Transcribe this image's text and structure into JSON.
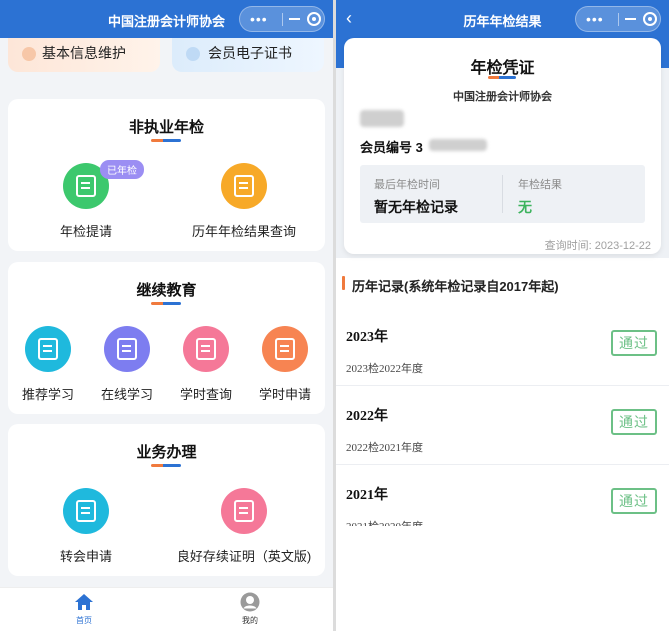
{
  "left": {
    "navbar": {
      "title": "中国注册会计师协会"
    },
    "top_links": {
      "info": "基本信息维护",
      "cert": "会员电子证书"
    },
    "annual_check": {
      "title": "非执业年检",
      "items": [
        {
          "label": "年检提请",
          "badge": "已年检",
          "color": "#3cc86d"
        },
        {
          "label": "历年年检结果查询",
          "color": "#f7a928"
        }
      ]
    },
    "education": {
      "title": "继续教育",
      "items": [
        {
          "label": "推荐学习",
          "color": "#1fb9dd"
        },
        {
          "label": "在线学习",
          "color": "#7d7df0"
        },
        {
          "label": "学时查询",
          "color": "#f57898"
        },
        {
          "label": "学时申请",
          "color": "#f78452"
        }
      ]
    },
    "business": {
      "title": "业务办理",
      "items": [
        {
          "label": "转会申请",
          "color": "#1fb9dd"
        },
        {
          "label": "良好存续证明（英文版)",
          "color": "#f57898"
        }
      ]
    },
    "tabbar": {
      "home": "首页",
      "mine": "我的",
      "active_color": "#2c72d3"
    }
  },
  "right": {
    "navbar": {
      "title": "历年年检结果"
    },
    "certificate": {
      "title": "年检凭证",
      "org": "中国注册会计师协会",
      "member_label": "会员编号 3",
      "last_check_key": "最后年检时间",
      "last_check_value": "暂无年检记录",
      "result_key": "年检结果",
      "result_value": "无",
      "query_time": "查询时间: 2023-12-22"
    },
    "section_title": "历年记录(系统年检记录自2017年起)",
    "records": [
      {
        "year": "2023年",
        "desc": "2023检2022年度",
        "status": "通过"
      },
      {
        "year": "2022年",
        "desc": "2022检2021年度",
        "status": "通过"
      },
      {
        "year": "2021年",
        "desc": "2021检2020年度",
        "status": "通过"
      }
    ],
    "pass_color": "#6cc086"
  }
}
